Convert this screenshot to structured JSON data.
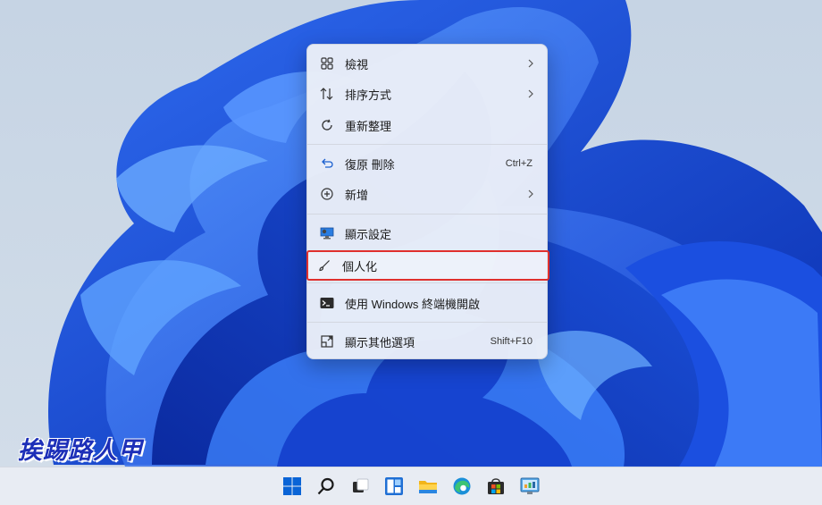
{
  "menu": {
    "items": [
      {
        "label": "檢視",
        "icon": "grid-view-icon",
        "submenu": true
      },
      {
        "label": "排序方式",
        "icon": "sort-icon",
        "submenu": true
      },
      {
        "label": "重新整理",
        "icon": "refresh-icon"
      },
      {
        "label": "復原 刪除",
        "icon": "undo-icon",
        "shortcut": "Ctrl+Z"
      },
      {
        "label": "新增",
        "icon": "new-plus-icon",
        "submenu": true
      },
      {
        "label": "顯示設定",
        "icon": "display-settings-icon"
      },
      {
        "label": "個人化",
        "icon": "brush-icon"
      },
      {
        "label": "使用 Windows 終端機開啟",
        "icon": "terminal-icon"
      },
      {
        "label": "顯示其他選項",
        "icon": "more-options-icon",
        "shortcut": "Shift+F10"
      }
    ],
    "selected_index": 6
  },
  "watermark": "挨踢路人甲",
  "taskbar": {
    "icons": [
      "windows-start-icon",
      "search-icon",
      "task-view-icon",
      "widgets-icon",
      "file-explorer-icon",
      "edge-browser-icon",
      "microsoft-store-icon",
      "control-panel-icon"
    ]
  },
  "colors": {
    "accent": "#0a64d6",
    "highlight_border": "#e0302d"
  }
}
